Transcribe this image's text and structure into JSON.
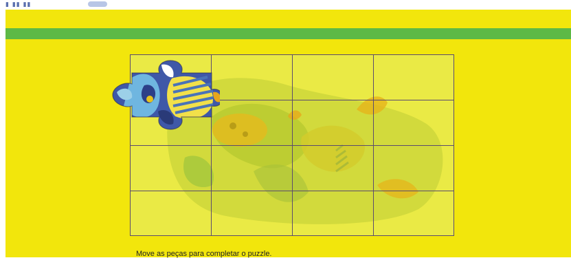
{
  "instructions": "Move as peças para completar o puzzle.",
  "colors": {
    "background": "#f2e60c",
    "band": "#5db946",
    "grid_line": "#5a4a6e",
    "board_fill": "#eaea45"
  },
  "puzzle": {
    "rows": 4,
    "columns": 4,
    "placed_pieces": 1
  }
}
